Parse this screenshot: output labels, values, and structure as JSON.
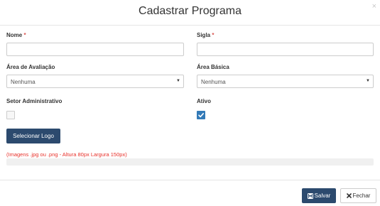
{
  "modal": {
    "title": "Cadastrar Programa",
    "close_glyph": "×"
  },
  "form": {
    "nome": {
      "label": "Nome",
      "required_mark": "*",
      "value": ""
    },
    "sigla": {
      "label": "Sigla",
      "required_mark": "*",
      "value": ""
    },
    "area_avaliacao": {
      "label": "Área de Avaliação",
      "selected": "Nenhuma"
    },
    "area_basica": {
      "label": "Área Básica",
      "selected": "Nenhuma"
    },
    "setor_administrativo": {
      "label": "Setor Administrativo",
      "checked": false
    },
    "ativo": {
      "label": "Ativo",
      "checked": true
    },
    "logo_button_label": "Selecionar Logo",
    "logo_hint": "(Imagens .jpg ou .png - Altura 80px Largura 150px)",
    "upload_progress": 0
  },
  "footer": {
    "save_label": "Salvar",
    "close_label": "Fechar"
  },
  "colors": {
    "primary": "#2c4a6e",
    "checkbox_checked": "#337ab7",
    "required": "#d9534f",
    "hint": "#e8312a"
  },
  "icons": {
    "save": "floppy-disk-icon",
    "close": "x-icon",
    "dropdown": "caret-down-icon",
    "check": "check-icon"
  }
}
